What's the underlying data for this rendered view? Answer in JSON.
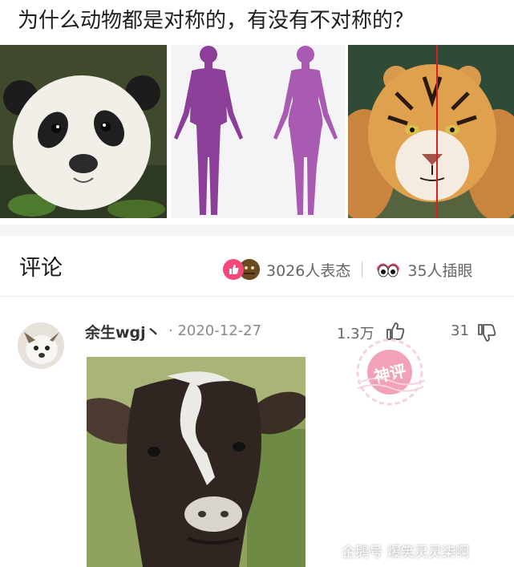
{
  "question": "为什么动物都是对称的，有没有不对称的？",
  "images": {
    "panda": "panda-photo",
    "human": "human-silhouettes",
    "tiger": "tiger-photo"
  },
  "comments": {
    "title": "评论",
    "reactions_count": "3026人表态",
    "insert_eyes_count": "35人插眼"
  },
  "comment": {
    "user": "余生wgj丶",
    "date": "· 2020-12-27",
    "likes": "1.3万",
    "dislikes": "31",
    "stamp_text": "神评"
  },
  "watermark": {
    "platform": "企鹅号",
    "account": "爆笑灵灵柒啊"
  },
  "colors": {
    "accent_pink": "#f4487a",
    "silhouette_purple": "#8b3f99",
    "stamp_pink": "#f2a2b6"
  }
}
